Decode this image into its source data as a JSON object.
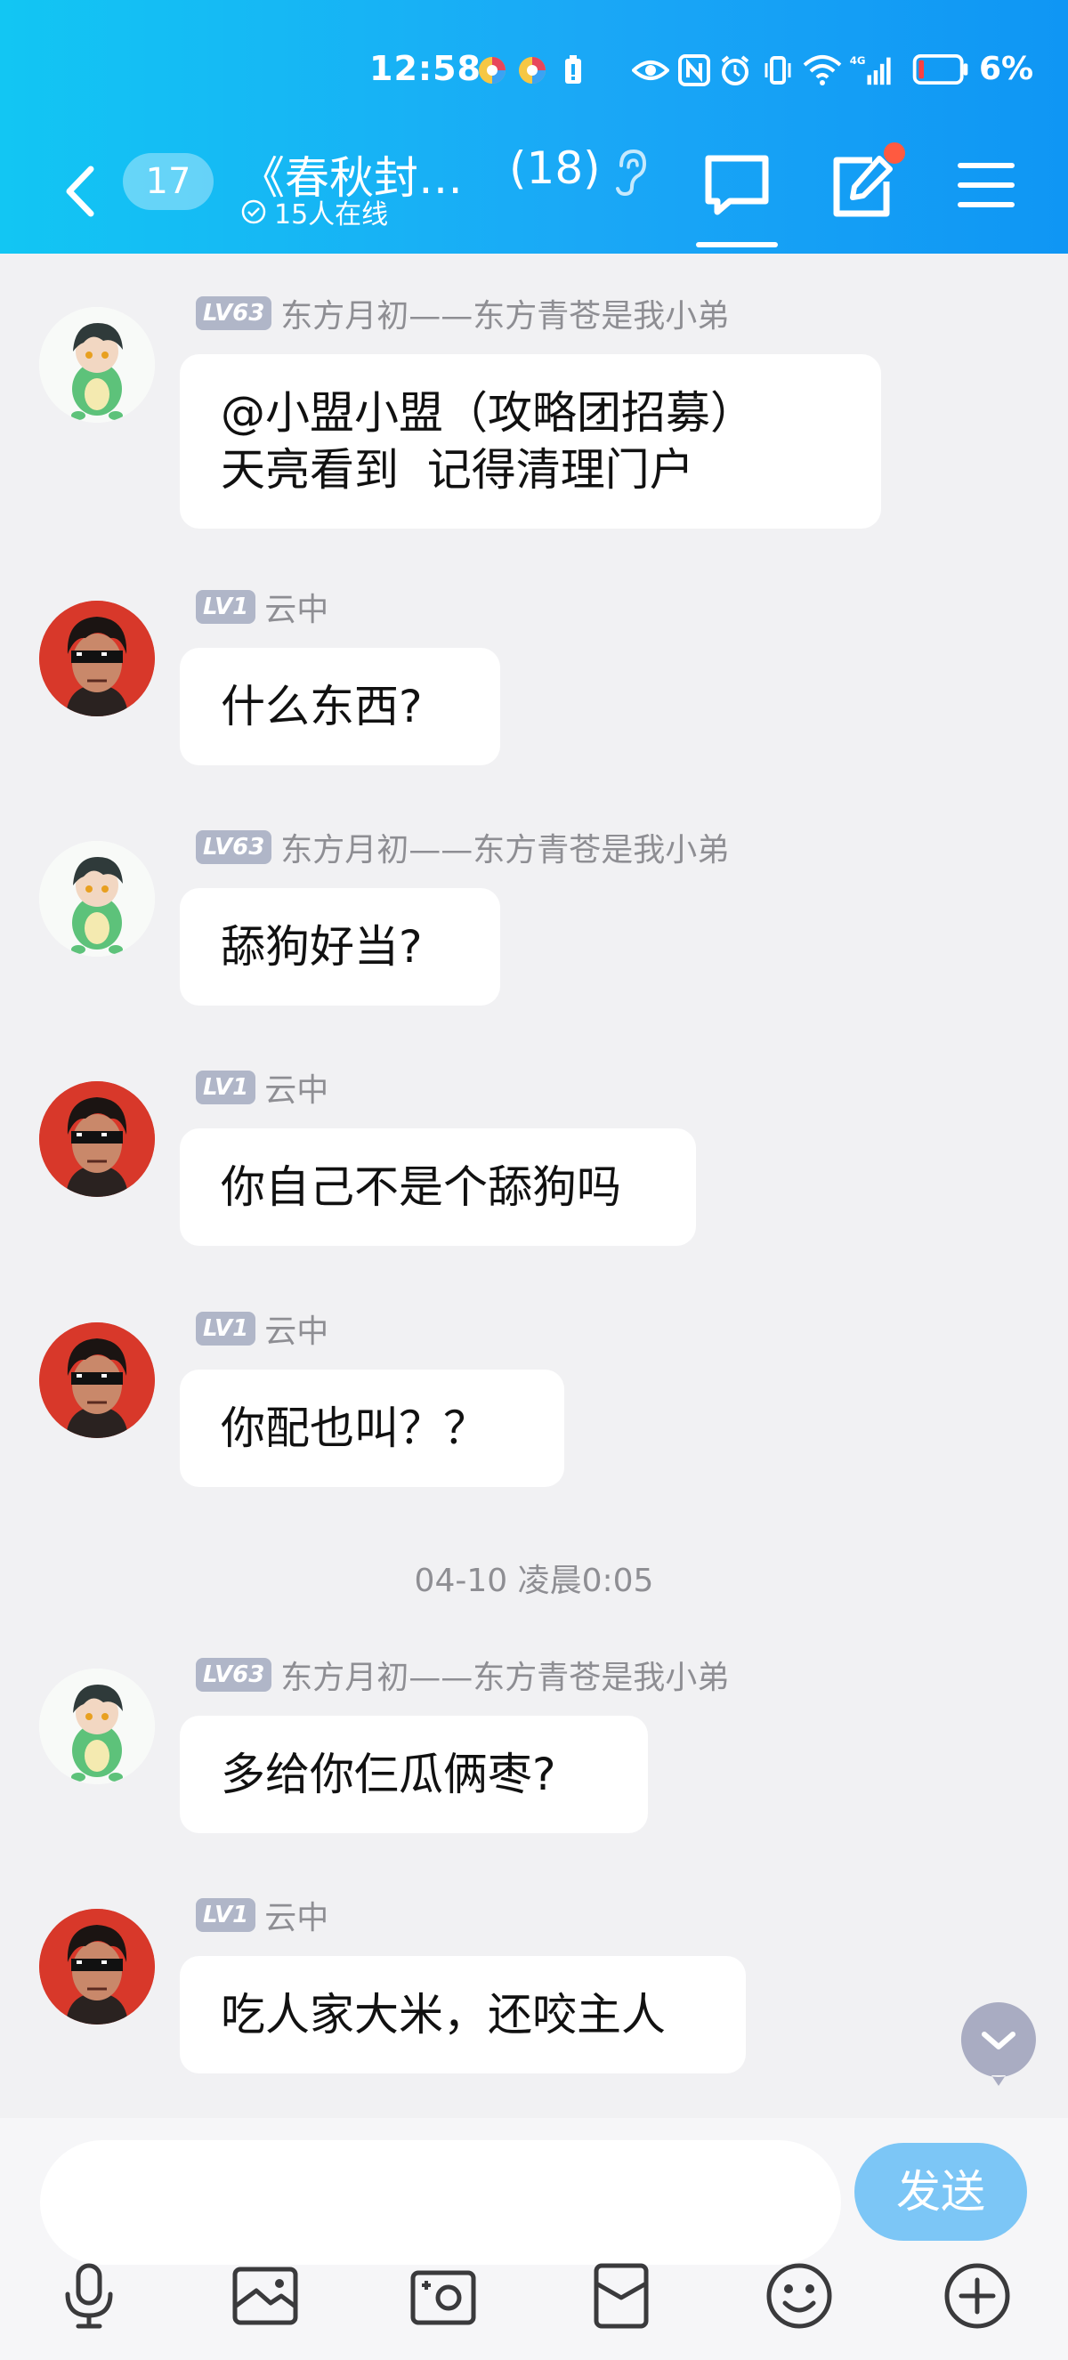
{
  "status_bar": {
    "time": "12:58",
    "network": "4G",
    "battery": "6%"
  },
  "header": {
    "unread_count": "17",
    "group_title": "《春秋封…",
    "member_count": "(18)",
    "online_status": "15人在线"
  },
  "messages": [
    {
      "level": "LV63",
      "sender": "东方月初——东方青苍是我小弟",
      "avatar": "green-dino-character",
      "text": "@小盟小盟（攻略团招募）\n天亮看到  记得清理门户"
    },
    {
      "level": "LV1",
      "sender": "云中",
      "avatar": "sunglasses-character",
      "text": "什么东西?"
    },
    {
      "level": "LV63",
      "sender": "东方月初——东方青苍是我小弟",
      "avatar": "green-dino-character",
      "text": "舔狗好当?"
    },
    {
      "level": "LV1",
      "sender": "云中",
      "avatar": "sunglasses-character",
      "text": "你自己不是个舔狗吗"
    },
    {
      "level": "LV1",
      "sender": "云中",
      "avatar": "sunglasses-character",
      "text": "你配也叫？？"
    },
    {
      "level": "LV63",
      "sender": "东方月初——东方青苍是我小弟",
      "avatar": "green-dino-character",
      "text": "多给你仨瓜俩枣?"
    },
    {
      "level": "LV1",
      "sender": "云中",
      "avatar": "sunglasses-character",
      "text": "吃人家大米，还咬主人"
    }
  ],
  "timestamp_divider": "04-10 凌晨0:05",
  "composer": {
    "placeholder": "",
    "send_label": "发送"
  },
  "colors": {
    "header_start": "#12c6f3",
    "header_end": "#0f96f4",
    "send_button": "#7cc6f6",
    "badge_dot": "#ff5a40"
  }
}
